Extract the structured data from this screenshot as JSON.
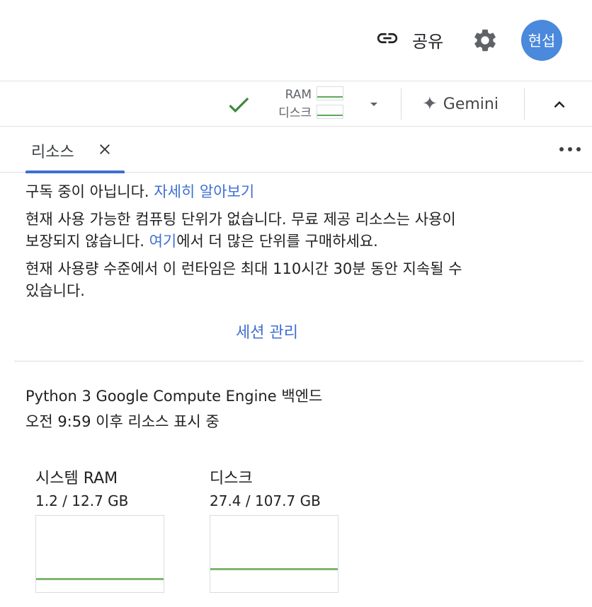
{
  "topbar": {
    "share_label": "공유",
    "avatar_text": "현섭",
    "avatar_color": "#4a89dc"
  },
  "toolbar": {
    "ram_label": "RAM",
    "disk_label": "디스크",
    "gemini_label": "Gemini",
    "status_color": "#3c8a3c"
  },
  "tabs": [
    {
      "label": "리소스",
      "active": true
    }
  ],
  "notice": {
    "subscription_text": "구독 중이 아닙니다.",
    "learn_more_link": "자세히 알아보기",
    "units_line": "현재 사용 가능한 컴퓨팅 단위가 없습니다. 무료 제공 리소스는 사용이",
    "units_line2_pre": "보장되지 않습니다. ",
    "here_link": "여기",
    "units_line2_post": "에서 더 많은 단위를 구매하세요.",
    "runtime_line1": "현재 사용량 수준에서 이 런타임은 최대 110시간 30분 동안 지속될 수",
    "runtime_line2": "있습니다."
  },
  "manage_sessions_link": "세션 관리",
  "backend": {
    "name": "Python 3 Google Compute Engine 백엔드",
    "since": "오전 9:59 이후 리소스 표시 중"
  },
  "resources": [
    {
      "title": "시스템 RAM",
      "value": "1.2 / 12.7 GB",
      "used_fraction": 0.094
    },
    {
      "title": "디스크",
      "value": "27.4 / 107.7 GB",
      "used_fraction": 0.254
    }
  ],
  "icons": {
    "share": "link-icon",
    "settings": "gear-icon",
    "connected": "check-icon",
    "dropdown": "caret-down-icon",
    "gemini": "sparkle-icon",
    "collapse": "chevron-up-icon",
    "close": "close-icon",
    "more": "more-horiz-icon"
  },
  "colors": {
    "link": "#3f6fd1",
    "graph_line": "#7fb66f"
  }
}
